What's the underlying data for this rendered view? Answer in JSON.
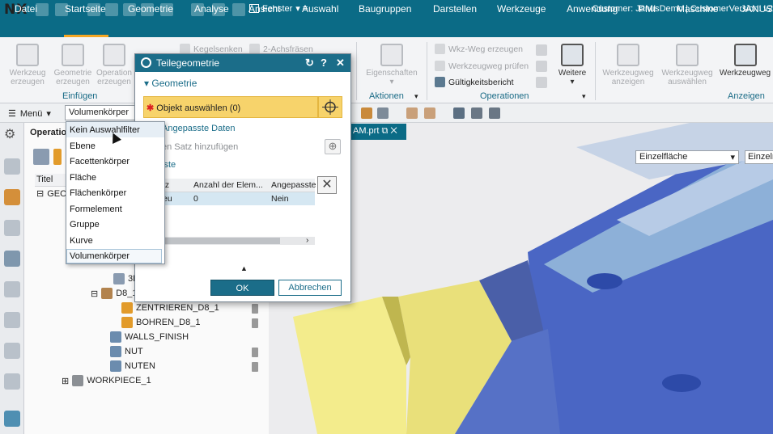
{
  "app": {
    "logo": "NX",
    "window_menu": "Fenster",
    "customer": "Customer: JanusDemo | CustomerVersion: v2"
  },
  "menubar": {
    "tabs": [
      "Datei",
      "Startseite",
      "Geometrie",
      "Analyse",
      "Ansicht",
      "Auswahl",
      "Baugruppen",
      "Darstellen",
      "Werkzeuge",
      "Anwendung",
      "PMI",
      "Maschine",
      "JANUS"
    ]
  },
  "ribbon": {
    "btn_werkzeug": "Werkzeug erzeugen",
    "btn_geometrie": "Geometrie erzeugen",
    "btn_operation": "Operation erzeugen",
    "group_einfuegen": "Einfügen",
    "small_kegel": "Kegelsenken",
    "small_achs": "2-Achsfräsen",
    "btn_eigenschaften": "Eigenschaften",
    "group_aktionen": "Aktionen",
    "small_wkz_weg": "Wkz-Weg erzeugen",
    "small_pruefen": "Werkzeugweg prüfen",
    "small_gueltig": "Gültigkeitsbericht",
    "group_operationen": "Operationen",
    "btn_weitere": "Weitere",
    "btn_wzweg_anzeigen": "Werkzeugweg anzeigen",
    "btn_wzweg_auswaehlen": "Werkzeugweg auswählen",
    "btn_wzweg": "Werkzeugweg",
    "group_anzeigen": "Anzeigen"
  },
  "toolbar": {
    "menu_label": "Menü",
    "filter_value": "Volumenkörper",
    "filter_options": [
      "Kein Auswahlfilter",
      "Ebene",
      "Facettenkörper",
      "Fläche",
      "Flächenkörper",
      "Formelement",
      "Gruppe",
      "Kurve",
      "Volumenkörper"
    ]
  },
  "navigator": {
    "header": "Operation",
    "col_title": "Titel",
    "rows": [
      "GEOM",
      "3D",
      "D8_1",
      "ZENTRIEREN_D8_1",
      "BOHREN_D8_1",
      "WALLS_FINISH",
      "NUT",
      "NUTEN",
      "WORKPIECE_1"
    ]
  },
  "viewport": {
    "tab_label": "AM.prt",
    "select_face": "Einzelfläche",
    "select_face2": "Einzeln"
  },
  "dialog": {
    "title": "Teilegeometrie",
    "section_geometry": "Geometrie",
    "select_object": "Objekt auswählen (0)",
    "custom_data": "Angepasste Daten",
    "add_set": "en Satz hinzufügen",
    "list_label": "iste",
    "col_set": "tz",
    "col_count": "Anzahl der Elem...",
    "col_custom": "Angepasste",
    "row_set": "eu",
    "row_count": "0",
    "row_custom": "Nein",
    "ok": "OK",
    "cancel": "Abbrechen"
  },
  "colors": {
    "brand": "#0b6b86",
    "accent": "#f5a623",
    "select_highlight": "#f7d36b"
  }
}
